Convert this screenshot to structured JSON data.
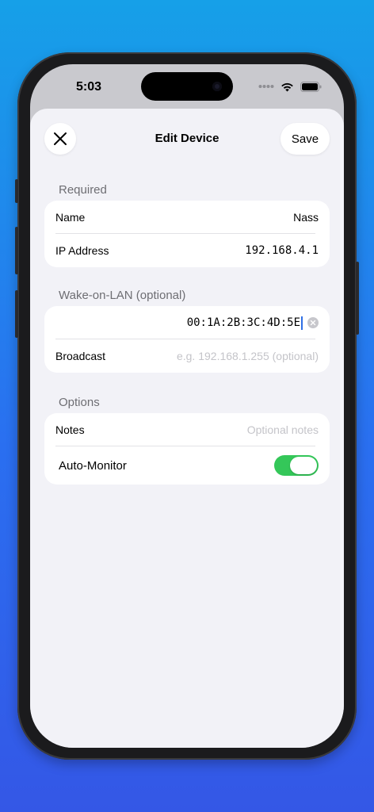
{
  "status_bar": {
    "time": "5:03"
  },
  "nav": {
    "title": "Edit Device",
    "save_label": "Save",
    "close_icon": "close-icon"
  },
  "sections": {
    "required": {
      "header": "Required",
      "name_label": "Name",
      "name_value": "Nass",
      "ip_label": "IP Address",
      "ip_value": "192.168.4.1"
    },
    "wol": {
      "header": "Wake-on-LAN (optional)",
      "mac_value": "00:1A:2B:3C:4D:5E",
      "broadcast_label": "Broadcast",
      "broadcast_placeholder": "e.g. 192.168.1.255 (optional)"
    },
    "options": {
      "header": "Options",
      "notes_label": "Notes",
      "notes_placeholder": "Optional notes",
      "auto_monitor_label": "Auto-Monitor",
      "auto_monitor_on": true
    }
  },
  "colors": {
    "toggle_on": "#34c759",
    "caret": "#2f6fe4",
    "sheet_bg": "#f2f2f7"
  }
}
